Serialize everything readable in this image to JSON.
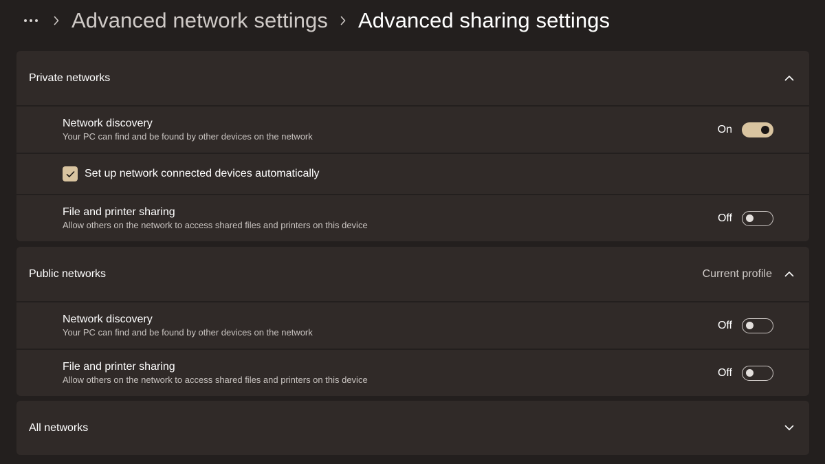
{
  "breadcrumb": {
    "more_icon": "more-horizontal-icon",
    "separator_icon": "chevron-right-icon",
    "parent": "Advanced network settings",
    "current": "Advanced sharing settings"
  },
  "colors": {
    "background": "#231f1e",
    "card": "#302a28",
    "accent": "#d9c4a0"
  },
  "private_networks": {
    "title": "Private networks",
    "expanded": true,
    "chevron_icon": "chevron-up-icon",
    "network_discovery": {
      "title": "Network discovery",
      "description": "Your PC can find and be found by other devices on the network",
      "state_label": "On",
      "on": true
    },
    "auto_setup": {
      "label": "Set up network connected devices automatically",
      "checked": true
    },
    "file_printer_sharing": {
      "title": "File and printer sharing",
      "description": "Allow others on the network to access shared files and printers on this device",
      "state_label": "Off",
      "on": false
    }
  },
  "public_networks": {
    "title": "Public networks",
    "note": "Current profile",
    "expanded": true,
    "chevron_icon": "chevron-up-icon",
    "network_discovery": {
      "title": "Network discovery",
      "description": "Your PC can find and be found by other devices on the network",
      "state_label": "Off",
      "on": false
    },
    "file_printer_sharing": {
      "title": "File and printer sharing",
      "description": "Allow others on the network to access shared files and printers on this device",
      "state_label": "Off",
      "on": false
    }
  },
  "all_networks": {
    "title": "All networks",
    "expanded": false,
    "chevron_icon": "chevron-down-icon"
  }
}
